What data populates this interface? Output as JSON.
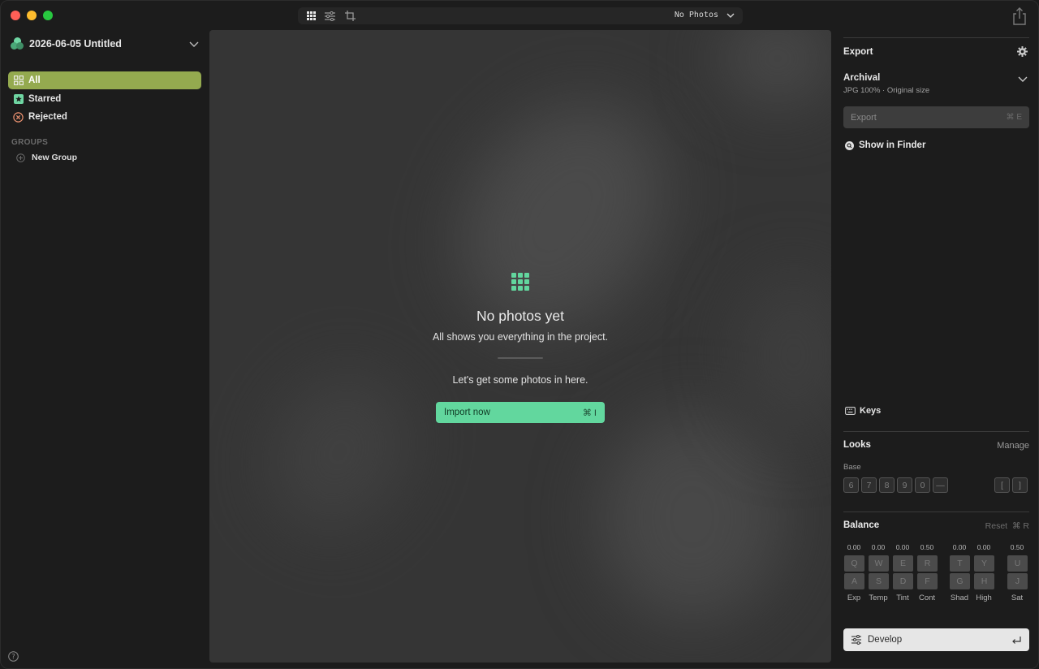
{
  "toolbar": {
    "status": "No Photos"
  },
  "sidebar": {
    "project_title": "2026-06-05 Untitled",
    "nav": [
      {
        "label": "All",
        "icon": "grid-icon",
        "active": true
      },
      {
        "label": "Starred",
        "icon": "star-icon"
      },
      {
        "label": "Rejected",
        "icon": "reject-icon"
      }
    ],
    "groups_label": "GROUPS",
    "new_group_label": "New Group"
  },
  "main": {
    "empty_title": "No photos yet",
    "empty_subtitle": "All shows you everything in the project.",
    "cta_text": "Let's get some photos in here.",
    "import_label": "Import now",
    "import_shortcut": "⌘ I"
  },
  "panel": {
    "export_title": "Export",
    "preset_name": "Archival",
    "preset_detail": "JPG 100% · Original size",
    "export_button": "Export",
    "export_shortcut": "⌘ E",
    "show_in_finder": "Show in Finder",
    "keys_label": "Keys",
    "looks_title": "Looks",
    "manage_label": "Manage",
    "base_label": "Base",
    "look_keys": [
      "6",
      "7",
      "8",
      "9",
      "0",
      "—"
    ],
    "look_nav_keys": [
      "[",
      "]"
    ],
    "balance_title": "Balance",
    "reset_label": "Reset",
    "reset_shortcut": "⌘ R",
    "balance": [
      {
        "value": "0.00",
        "up": "Q",
        "down": "A",
        "label": "Exp"
      },
      {
        "value": "0.00",
        "up": "W",
        "down": "S",
        "label": "Temp"
      },
      {
        "value": "0.00",
        "up": "E",
        "down": "D",
        "label": "Tint"
      },
      {
        "value": "0.50",
        "up": "R",
        "down": "F",
        "label": "Cont"
      },
      {
        "value": "0.00",
        "up": "T",
        "down": "G",
        "label": "Shad"
      },
      {
        "value": "0.00",
        "up": "Y",
        "down": "H",
        "label": "High"
      },
      {
        "value": "0.50",
        "up": "U",
        "down": "J",
        "label": "Sat"
      }
    ],
    "develop_label": "Develop"
  },
  "colors": {
    "accent_green": "#62d79e",
    "active_nav": "#94aa4f"
  }
}
